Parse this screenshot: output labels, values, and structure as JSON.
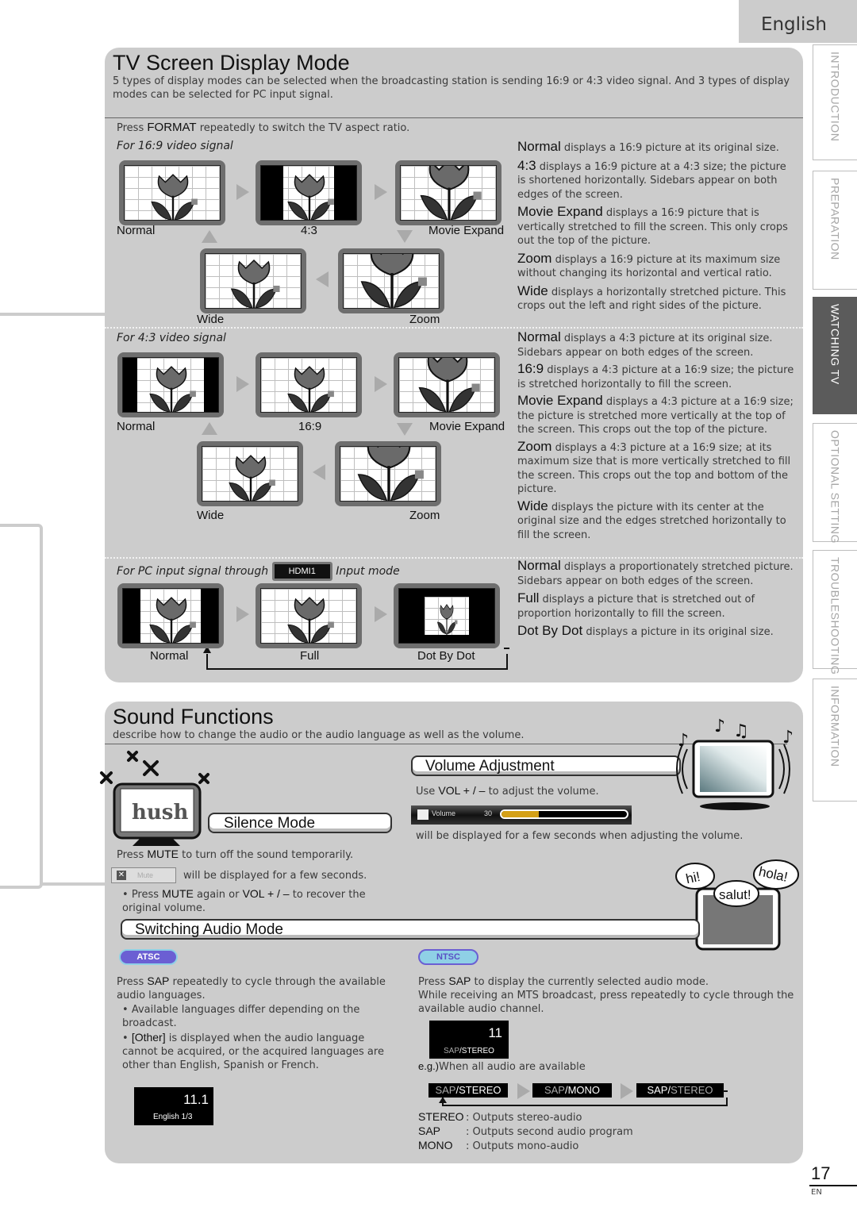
{
  "language_tab": "English",
  "side_tabs": [
    {
      "label": "INTRODUCTION",
      "active": false
    },
    {
      "label": "PREPARATION",
      "active": false
    },
    {
      "label": "WATCHING TV",
      "active": true
    },
    {
      "label": "OPTIONAL SETTING",
      "active": false
    },
    {
      "label": "TROUBLESHOOTING",
      "active": false
    },
    {
      "label": "INFORMATION",
      "active": false
    }
  ],
  "display_mode": {
    "title": "TV Screen Display Mode",
    "intro": "5 types of display modes can be selected when the broadcasting station is sending 16:9 or 4:3 video signal. And 3 types of display modes can be selected for PC input signal.",
    "press_prefix": "Press ",
    "press_key": "FORMAT",
    "press_suffix": " repeatedly to switch the TV aspect ratio.",
    "signal_169": {
      "heading": "For 16:9 video signal",
      "modes": [
        "Normal",
        "4:3",
        "Movie Expand",
        "Zoom",
        "Wide"
      ],
      "descriptions": [
        {
          "term": "Normal",
          "text": " displays a 16:9 picture at its original size."
        },
        {
          "term": "4:3",
          "text": " displays a 16:9 picture at a 4:3 size; the picture is shortened horizontally. Sidebars appear on both edges of the screen."
        },
        {
          "term": "Movie Expand",
          "text": " displays a 16:9 picture that is vertically stretched to fill the screen. This only crops out the top of the picture."
        },
        {
          "term": "Zoom",
          "text": " displays a 16:9 picture at its maximum size without changing its horizontal and vertical ratio."
        },
        {
          "term": "Wide",
          "text": " displays a horizontally stretched picture. This crops out the left and right sides of the picture."
        }
      ]
    },
    "signal_43": {
      "heading": "For 4:3 video signal",
      "modes": [
        "Normal",
        "16:9",
        "Movie Expand",
        "Zoom",
        "Wide"
      ],
      "descriptions": [
        {
          "term": "Normal",
          "text": " displays a 4:3 picture at its original size. Sidebars appear on both edges of the screen."
        },
        {
          "term": "16:9",
          "text": " displays a 4:3 picture at a 16:9 size; the picture is stretched horizontally to fill the screen."
        },
        {
          "term": "Movie Expand",
          "text": " displays a 4:3 picture at a 16:9 size; the picture is stretched more vertically at the top of the screen. This crops out the top of the picture."
        },
        {
          "term": "Zoom",
          "text": " displays a 4:3 picture at a 16:9 size; at its maximum size that is more vertically stretched to fill the screen. This crops out the top and bottom of the picture."
        },
        {
          "term": "Wide",
          "text": " displays the picture with its center at the original size and the edges stretched horizontally to fill the screen."
        }
      ]
    },
    "signal_pc": {
      "heading_prefix": "For PC input signal through",
      "input_badge": "HDMI1",
      "heading_suffix": "Input mode",
      "modes": [
        "Normal",
        "Full",
        "Dot By Dot"
      ],
      "descriptions": [
        {
          "term": "Normal",
          "text": " displays a proportionately stretched picture. Sidebars appear on both edges of the screen."
        },
        {
          "term": "Full",
          "text": " displays a picture that is stretched out of proportion horizontally to fill the screen."
        },
        {
          "term": "Dot By Dot",
          "text": " displays a picture in its original size."
        }
      ]
    }
  },
  "sound": {
    "title": "Sound Functions",
    "intro": "describe how to change the audio or  the audio language as well as the volume.",
    "silence": {
      "heading": "Silence Mode",
      "hush_text": "hush",
      "press_prefix": "Press ",
      "press_key": "MUTE",
      "press_suffix": " to turn off the sound temporarily.",
      "osd_label": "Mute",
      "osd_note": "will be displayed for a few seconds.",
      "bullet_prefix": "Press ",
      "bullet_key1": "MUTE",
      "bullet_mid": " again or ",
      "bullet_key2": "VOL + / –",
      "bullet_suffix": " to recover the original volume."
    },
    "volume": {
      "heading": "Volume Adjustment",
      "use_prefix": "Use ",
      "use_key": "VOL + / –",
      "use_suffix": " to adjust the volume.",
      "osd_label": "Volume",
      "osd_value": "30",
      "level_percent": 30,
      "note": "will be displayed for a few seconds when adjusting the volume."
    },
    "speech_bubbles": [
      "hi!",
      "salut!",
      "hola!"
    ],
    "switching": {
      "heading": "Switching Audio Mode",
      "atsc": {
        "badge": "ATSC",
        "press_prefix": "Press ",
        "press_key": "SAP",
        "press_suffix": " repeatedly to cycle through the available audio languages.",
        "bullets": [
          {
            "key": "",
            "text": "Available languages differ depending on the broadcast."
          },
          {
            "key": "[Other]",
            "text": " is displayed when the audio language cannot be acquired, or the acquired languages are other than English, Spanish or French."
          }
        ],
        "osd_channel": "11.1",
        "osd_language": "English 1/3"
      },
      "ntsc": {
        "badge": "NTSC",
        "press_prefix": "Press ",
        "press_key": "SAP",
        "press_suffix": " to display the currently selected audio mode.",
        "line2": "While receiving an MTS broadcast, press repeatedly to cycle through the available audio channel.",
        "osd_channel": "11",
        "osd_mode_dim": "SAP",
        "osd_mode_sep": "/",
        "osd_mode_bright": "STEREO",
        "eg_prefix": "e.g.)",
        "eg_text": "When all audio are available",
        "cycle": [
          {
            "dim": "SAP",
            "sep": "/",
            "bright": "STEREO",
            "bright_first": false
          },
          {
            "dim": "SAP",
            "sep": "/",
            "bright": "MONO",
            "bright_first": false
          },
          {
            "bright": "SAP",
            "sep": "/",
            "dim": "STEREO",
            "bright_first": true
          }
        ],
        "legend": [
          {
            "term": "STEREO",
            "text": ": Outputs stereo-audio"
          },
          {
            "term": "SAP",
            "text": ": Outputs second audio program"
          },
          {
            "term": "MONO",
            "text": ": Outputs mono-audio"
          }
        ]
      }
    }
  },
  "page": {
    "number": "17",
    "lang_code": "EN"
  }
}
